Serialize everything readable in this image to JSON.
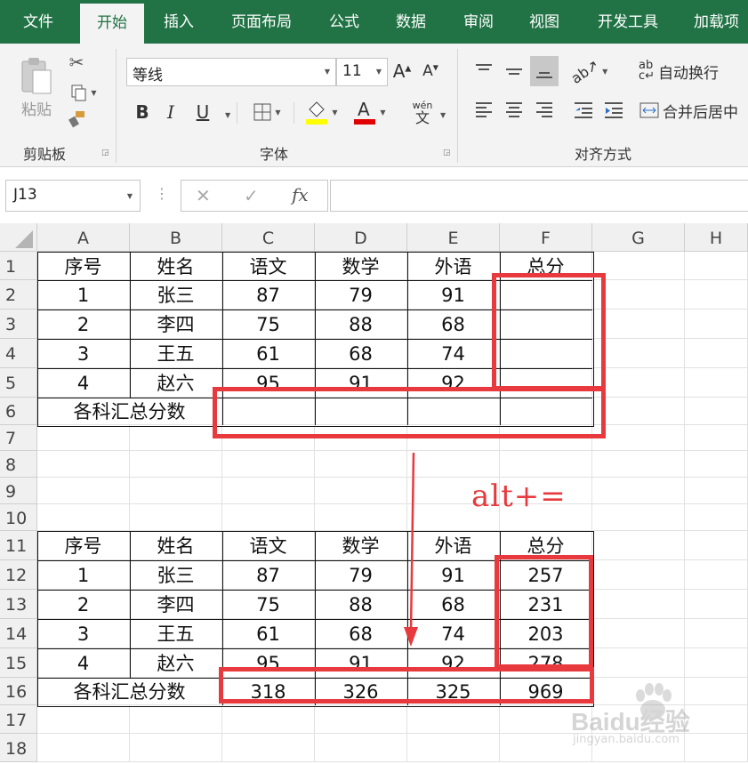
{
  "ribbon_tabs": [
    "文件",
    "开始",
    "插入",
    "页面布局",
    "公式",
    "数据",
    "审阅",
    "视图",
    "开发工具",
    "加载项"
  ],
  "clipboard": {
    "paste_label": "粘贴",
    "group_label": "剪贴板"
  },
  "font": {
    "font_name": "等线",
    "font_size": "11",
    "bold": "B",
    "italic": "I",
    "underline": "U",
    "wen_label": "wén",
    "wen_char": "文",
    "group_label": "字体",
    "fill_color": "#ffff00",
    "font_color": "#e00000"
  },
  "alignment": {
    "wrap_text_label": "自动换行",
    "merge_center_label": "合并后居中",
    "group_label": "对齐方式",
    "ab_glyph": "ab",
    "c_glyph": "c"
  },
  "formula_bar": {
    "name_box": "J13",
    "cancel": "✕",
    "enter": "✓",
    "fx": "fx",
    "formula": ""
  },
  "columns": [
    "A",
    "B",
    "C",
    "D",
    "E",
    "F",
    "G",
    "H"
  ],
  "rows": [
    "1",
    "2",
    "3",
    "4",
    "5",
    "6",
    "7",
    "8",
    "9",
    "10",
    "11",
    "12",
    "13",
    "14",
    "15",
    "16",
    "17",
    "18"
  ],
  "table1": {
    "headers": [
      "序号",
      "姓名",
      "语文",
      "数学",
      "外语",
      "总分"
    ],
    "rows": [
      [
        "1",
        "张三",
        "87",
        "79",
        "91",
        ""
      ],
      [
        "2",
        "李四",
        "75",
        "88",
        "68",
        ""
      ],
      [
        "3",
        "王五",
        "61",
        "68",
        "74",
        ""
      ],
      [
        "4",
        "赵六",
        "95",
        "91",
        "92",
        ""
      ]
    ],
    "total_label": "各科汇总分数",
    "totals": [
      "",
      "",
      "",
      ""
    ]
  },
  "table2": {
    "headers": [
      "序号",
      "姓名",
      "语文",
      "数学",
      "外语",
      "总分"
    ],
    "rows": [
      [
        "1",
        "张三",
        "87",
        "79",
        "91",
        "257"
      ],
      [
        "2",
        "李四",
        "75",
        "88",
        "68",
        "231"
      ],
      [
        "3",
        "王五",
        "61",
        "68",
        "74",
        "203"
      ],
      [
        "4",
        "赵六",
        "95",
        "91",
        "92",
        "278"
      ]
    ],
    "total_label": "各科汇总分数",
    "totals": [
      "318",
      "326",
      "325",
      "969"
    ]
  },
  "annotation": {
    "shortcut": "alt+=",
    "color": "#e83a3e"
  },
  "watermark": {
    "brand": "Baidu经验",
    "url": "jingyan.baidu.com"
  }
}
